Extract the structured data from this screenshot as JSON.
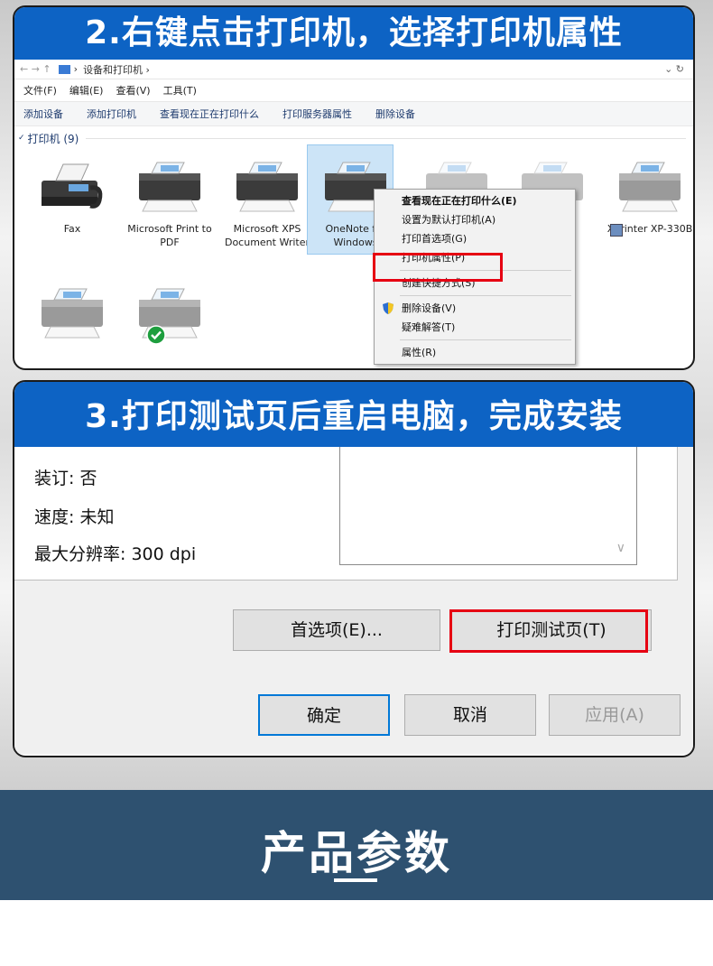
{
  "step2": {
    "title": "2.右键点击打印机，选择打印机属性",
    "address": {
      "nav": "←  →  ↑",
      "path": "设备和打印机  ›",
      "crumb_sep": "›",
      "right": "⌄  ↻"
    },
    "menu": [
      "文件(F)",
      "编辑(E)",
      "查看(V)",
      "工具(T)"
    ],
    "commands": [
      "添加设备",
      "添加打印机",
      "查看现在正在打印什么",
      "打印服务器属性",
      "删除设备"
    ],
    "group_label": "打印机 (9)",
    "devices": [
      {
        "label": "Fax"
      },
      {
        "label": "Microsoft Print to PDF"
      },
      {
        "label": "Microsoft XPS Document Writer"
      },
      {
        "label": "OneNote for Windows"
      },
      {
        "label": "Xprinter XP-330B"
      }
    ],
    "context_menu": {
      "items": [
        {
          "label": "查看现在正在打印什么(E)",
          "bold": true
        },
        {
          "label": "设置为默认打印机(A)"
        },
        {
          "label": "打印首选项(G)"
        },
        {
          "label": "打印机属性(P)"
        },
        {
          "label": "创建快捷方式(S)"
        },
        {
          "label": "删除设备(V)",
          "icon": "shield-icon"
        },
        {
          "label": "疑难解答(T)"
        },
        {
          "label": "属性(R)"
        }
      ]
    },
    "colors": {
      "header": "#0d63c4",
      "highlight": "#e60012"
    }
  },
  "step3": {
    "title": "3.打印测试页后重启电脑，完成安装",
    "properties": [
      "装订: 否",
      "速度: 未知",
      "最大分辨率: 300 dpi"
    ],
    "buttons": {
      "preferences": "首选项(E)...",
      "print_test": "打印测试页(T)",
      "ok": "确定",
      "cancel": "取消",
      "apply": "应用(A)"
    }
  },
  "section": {
    "title": "产品参数",
    "bg": "#2e5170"
  }
}
